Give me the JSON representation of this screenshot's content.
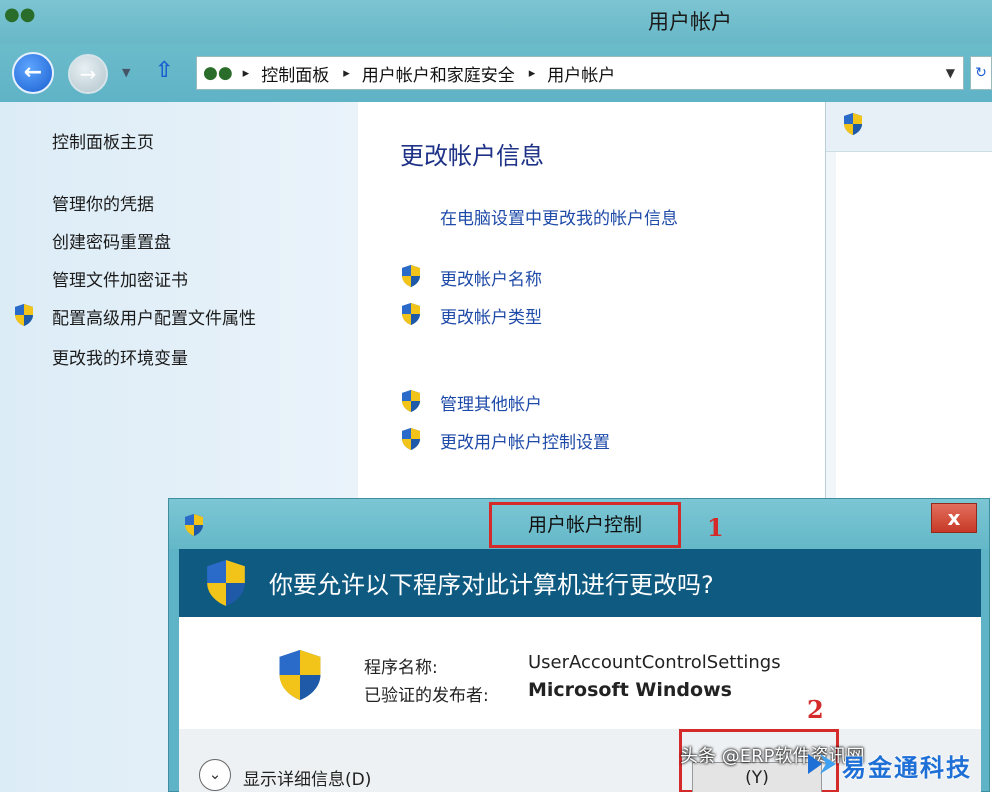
{
  "window": {
    "title": "用户帐户",
    "breadcrumbs": [
      "控制面板",
      "用户帐户和家庭安全",
      "用户帐户"
    ]
  },
  "left_nav": {
    "home": "控制面板主页",
    "items": [
      {
        "label": "管理你的凭据",
        "shield": false
      },
      {
        "label": "创建密码重置盘",
        "shield": false
      },
      {
        "label": "管理文件加密证书",
        "shield": false
      },
      {
        "label": "配置高级用户配置文件属性",
        "shield": true
      },
      {
        "label": "更改我的环境变量",
        "shield": false
      }
    ]
  },
  "main": {
    "heading": "更改帐户信息",
    "links": [
      {
        "label": "在电脑设置中更改我的帐户信息",
        "shield": false
      },
      {
        "label": "更改帐户名称",
        "shield": true
      },
      {
        "label": "更改帐户类型",
        "shield": true
      },
      {
        "label": "管理其他帐户",
        "shield": true
      },
      {
        "label": "更改用户帐户控制设置",
        "shield": true
      }
    ]
  },
  "uac_dialog": {
    "title": "用户帐户控制",
    "question": "你要允许以下程序对此计算机进行更改吗?",
    "program_name_label": "程序名称:",
    "program_name_value": "UserAccountControlSettings",
    "publisher_label": "已验证的发布者:",
    "publisher_value": "Microsoft Windows",
    "details_label": "显示详细信息(D)",
    "yes_button_label": "(Y)",
    "close_glyph": "x"
  },
  "annotations": {
    "marker_1": "1",
    "marker_2": "2"
  },
  "watermark": {
    "source_text": "头条 @ERP软件资讯网",
    "brand_text": "易金通科技"
  },
  "colors": {
    "link": "#1e4aa8",
    "heading": "#1e3287",
    "uac_banner": "#0f5a80",
    "highlight_box": "#d42a2a",
    "chrome": "#5fb3c6"
  },
  "icons": [
    "back-arrow-icon",
    "forward-arrow-icon",
    "up-arrow-icon",
    "control-panel-icon",
    "uac-shield-icon",
    "close-icon",
    "chevron-down-icon"
  ]
}
